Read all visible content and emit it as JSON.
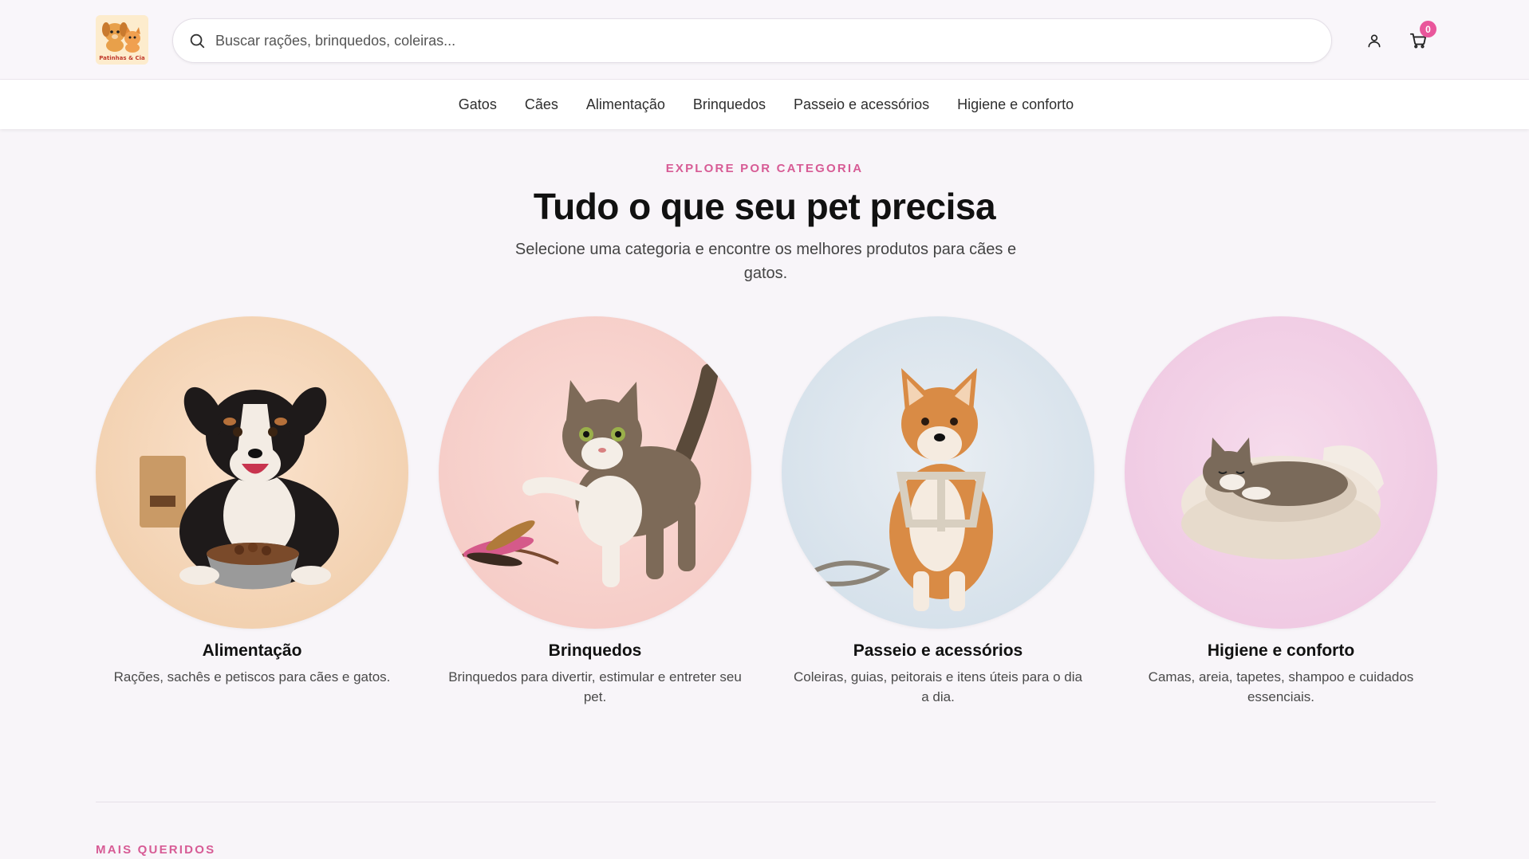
{
  "header": {
    "logo_text": "Patinhas & Cia",
    "search_placeholder": "Buscar rações, brinquedos, coleiras...",
    "cart_count": "0"
  },
  "nav": {
    "items": [
      "Gatos",
      "Cães",
      "Alimentação",
      "Brinquedos",
      "Passeio e acessórios",
      "Higiene e conforto"
    ]
  },
  "hero": {
    "eyebrow": "EXPLORE POR CATEGORIA",
    "title": "Tudo o que seu pet precisa",
    "subtitle": "Selecione uma categoria e encontre os melhores produtos para cães e gatos."
  },
  "categories": [
    {
      "title": "Alimentação",
      "description": "Rações, sachês e petiscos para cães e gatos."
    },
    {
      "title": "Brinquedos",
      "description": "Brinquedos para divertir, estimular e entreter seu pet."
    },
    {
      "title": "Passeio e acessórios",
      "description": "Coleiras, guias, peitorais e itens úteis para o dia a dia."
    },
    {
      "title": "Higiene e conforto",
      "description": "Camas, areia, tapetes, shampoo e cuidados essenciais."
    }
  ],
  "next_section": {
    "eyebrow": "MAIS QUERIDOS"
  },
  "colors": {
    "accent": "#d75b95",
    "badge": "#e9569b",
    "background": "#f8f5f9"
  },
  "icons": {
    "search": "search-icon",
    "user": "user-icon",
    "cart": "cart-icon"
  }
}
